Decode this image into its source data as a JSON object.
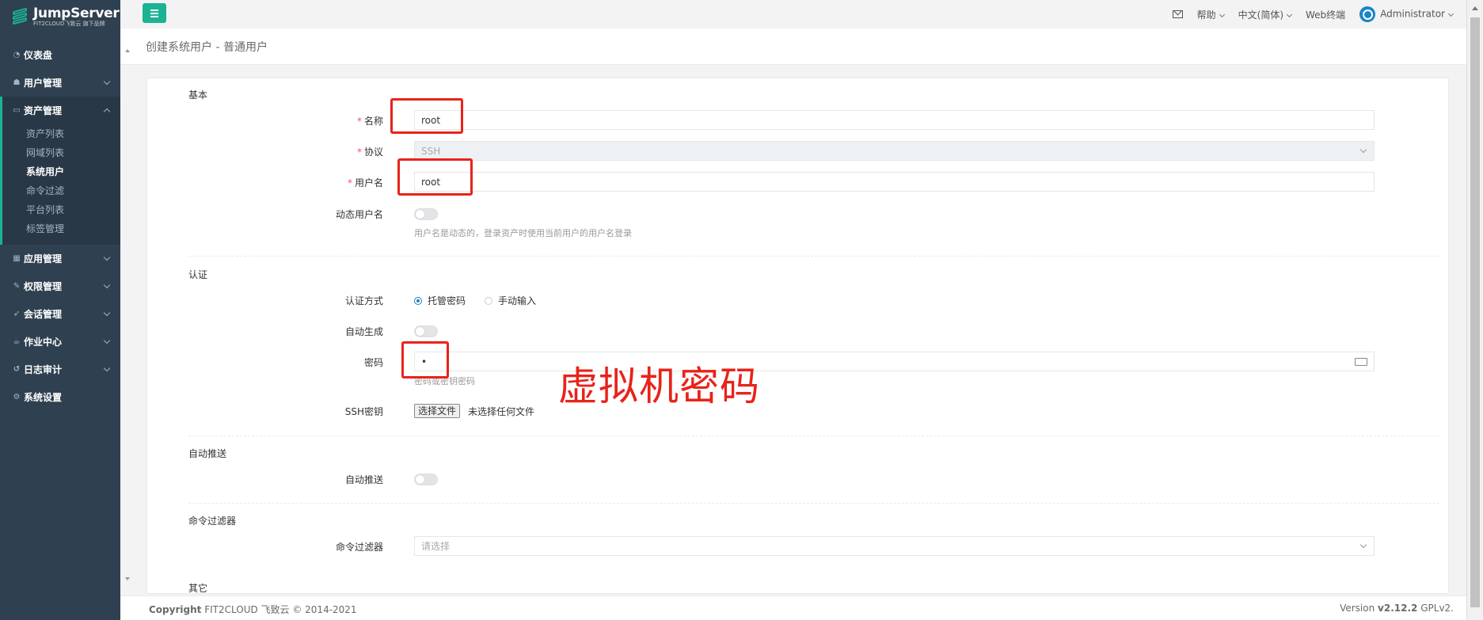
{
  "brand": {
    "title": "JumpServer",
    "subtitle": "FIT2CLOUD飞致云 旗下品牌"
  },
  "sidebar": {
    "items": [
      {
        "label": "仪表盘",
        "icon": "dashboard-icon"
      },
      {
        "label": "用户管理",
        "icon": "users-icon"
      },
      {
        "label": "资产管理",
        "icon": "inbox-icon",
        "expanded": true,
        "children": [
          "资产列表",
          "网域列表",
          "系统用户",
          "命令过滤",
          "平台列表",
          "标签管理"
        ],
        "current": "系统用户"
      },
      {
        "label": "应用管理",
        "icon": "grid-icon"
      },
      {
        "label": "权限管理",
        "icon": "edit-icon"
      },
      {
        "label": "会话管理",
        "icon": "rocket-icon"
      },
      {
        "label": "作业中心",
        "icon": "coffee-icon"
      },
      {
        "label": "日志审计",
        "icon": "history-icon"
      },
      {
        "label": "系统设置",
        "icon": "gears-icon"
      }
    ]
  },
  "topbar": {
    "help": "帮助",
    "language": "中文(简体)",
    "web_terminal": "Web终端",
    "user": "Administrator"
  },
  "page": {
    "title": "创建系统用户 - 普通用户"
  },
  "form": {
    "basic": {
      "section": "基本",
      "name_label": "名称",
      "name_value": "root",
      "protocol_label": "协议",
      "protocol_value": "SSH",
      "username_label": "用户名",
      "username_value": "root",
      "dynamic_label": "动态用户名",
      "dynamic_help": "用户名是动态的，登录资产时使用当前用户的用户名登录"
    },
    "auth": {
      "section": "认证",
      "method_label": "认证方式",
      "method_options": [
        "托管密码",
        "手动输入"
      ],
      "method_selected": "托管密码",
      "autogen_label": "自动生成",
      "password_label": "密码",
      "password_value": "•",
      "password_help": "密码或密钥密码",
      "sshkey_label": "SSH密钥",
      "file_button": "选择文件",
      "file_status": "未选择任何文件"
    },
    "push": {
      "section": "自动推送",
      "push_label": "自动推送"
    },
    "cmdfilter": {
      "section": "命令过滤器",
      "label": "命令过滤器",
      "placeholder": "请选择"
    },
    "other": {
      "section": "其它"
    }
  },
  "annotation": {
    "text": "虚拟机密码",
    "color": "#e8231a"
  },
  "footer": {
    "copyright_bold": "Copyright",
    "copyright": "FIT2CLOUD 飞致云 © 2014-2021",
    "version_prefix": "Version",
    "version": "v2.12.2",
    "license": "GPLv2."
  },
  "colors": {
    "sidebar": "#2f4050",
    "accent": "#1ab394",
    "required": "#ed5565",
    "link": "#1c84c6"
  }
}
